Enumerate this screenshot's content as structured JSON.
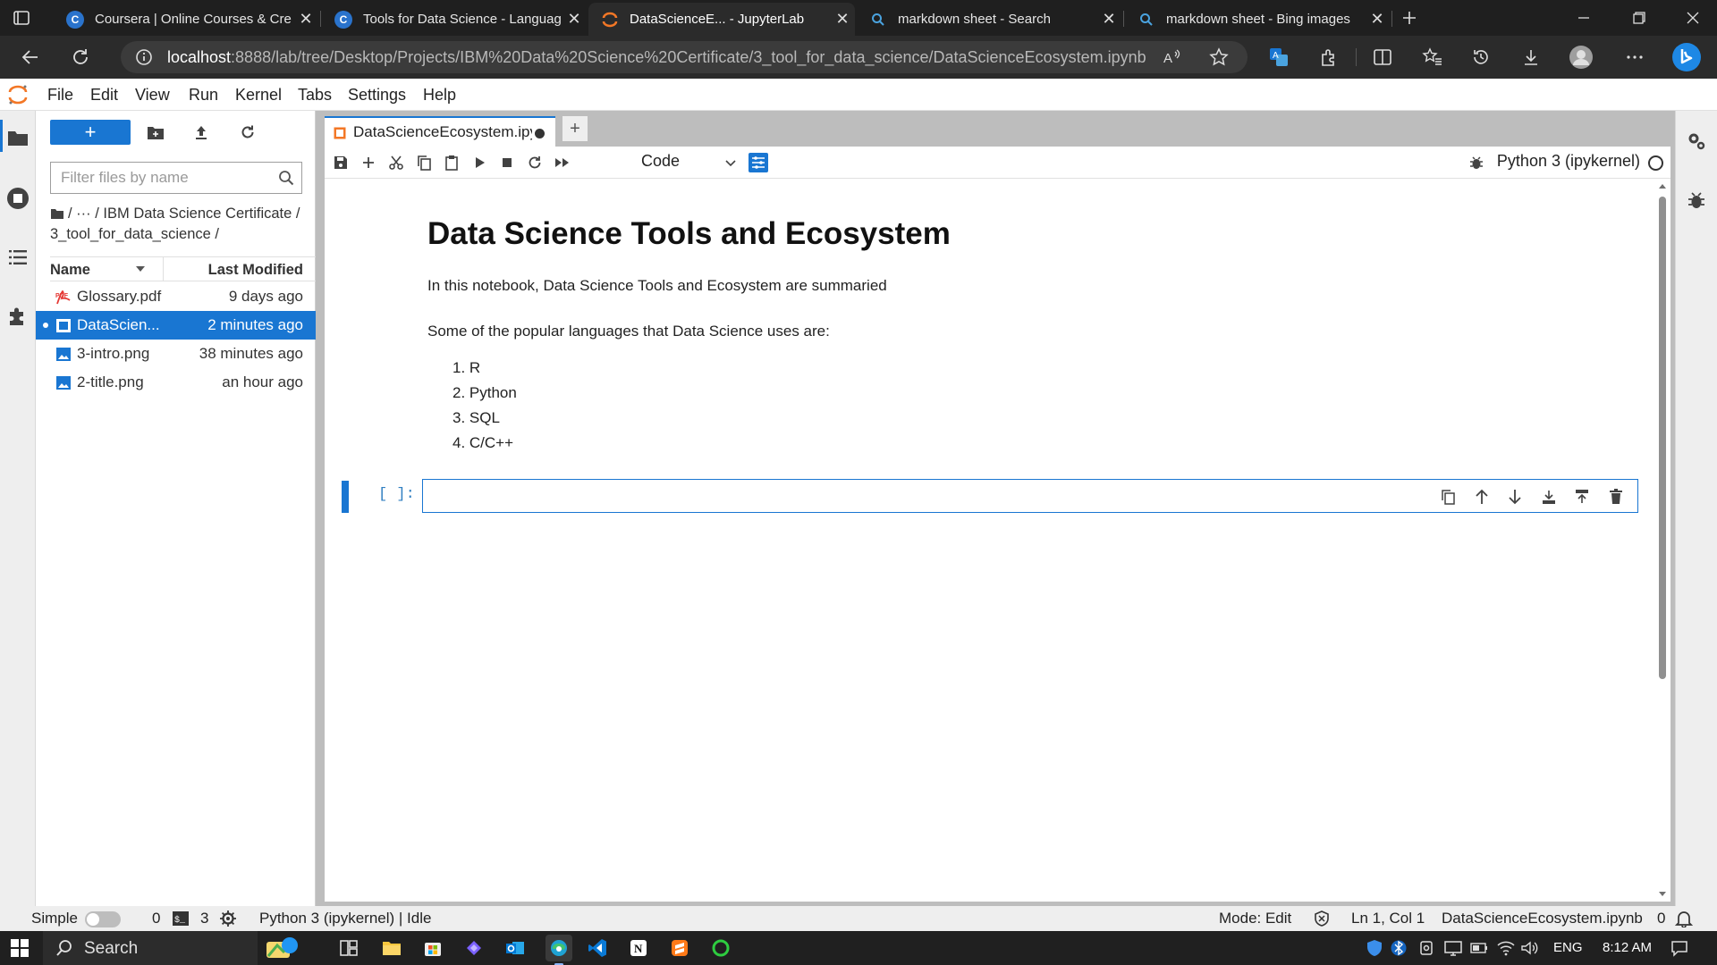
{
  "browser": {
    "tabs": [
      {
        "title": "Coursera | Online Courses & Cre",
        "favicon": "C",
        "favicon_color": "#2a73cc"
      },
      {
        "title": "Tools for Data Science - Languag",
        "favicon": "C",
        "favicon_color": "#2a73cc"
      },
      {
        "title": "DataScienceE... - JupyterLab",
        "favicon": "",
        "favicon_color": "#f37726"
      },
      {
        "title": "markdown sheet - Search",
        "favicon": "",
        "favicon_color": "#4aa3df"
      },
      {
        "title": "markdown sheet - Bing images",
        "favicon": "",
        "favicon_color": "#4aa3df"
      }
    ],
    "url_host": "localhost",
    "url_rest": ":8888/lab/tree/Desktop/Projects/IBM%20Data%20Science%20Certificate/3_tool_for_data_science/DataScienceEcosystem.ipynb"
  },
  "menu": [
    "File",
    "Edit",
    "View",
    "Run",
    "Kernel",
    "Tabs",
    "Settings",
    "Help"
  ],
  "filebrowser": {
    "new_label": "+",
    "filter_placeholder": "Filter files by name",
    "breadcrumb": "/ ··· / IBM Data Science Certificate / 3_tool_for_data_science /",
    "col_name": "Name",
    "col_modified": "Last Modified",
    "files": [
      {
        "name": "Glossary.pdf",
        "modified": "9 days ago",
        "type": "pdf"
      },
      {
        "name": "DataScien...",
        "modified": "2 minutes ago",
        "type": "notebook",
        "selected": true
      },
      {
        "name": "3-intro.png",
        "modified": "38 minutes ago",
        "type": "image"
      },
      {
        "name": "2-title.png",
        "modified": "an hour ago",
        "type": "image"
      }
    ]
  },
  "notebook": {
    "tab_title": "DataScienceEcosystem.ipynb",
    "cell_type": "Code",
    "kernel": "Python 3 (ipykernel)",
    "heading": "Data Science Tools and Ecosystem",
    "intro": "In this notebook, Data Science Tools and Ecosystem are summaried",
    "languages_intro": "Some of the popular languages that Data Science uses are:",
    "languages": [
      "1. R",
      "2. Python",
      "3. SQL",
      "4. C/C++"
    ],
    "prompt": "[ ]:"
  },
  "status": {
    "mode_label": "Simple",
    "terminals": "0",
    "kernels": "3",
    "kernel_status": "Python 3 (ipykernel) | Idle",
    "mode": "Mode: Edit",
    "cursor": "Ln 1, Col 1",
    "filename": "DataScienceEcosystem.ipynb",
    "notifications": "0"
  },
  "taskbar": {
    "search_label": "Search",
    "lang": "ENG",
    "time": "8:12 AM"
  },
  "colors": {
    "accent": "#1976d2",
    "jupyter_orange": "#f37726"
  }
}
